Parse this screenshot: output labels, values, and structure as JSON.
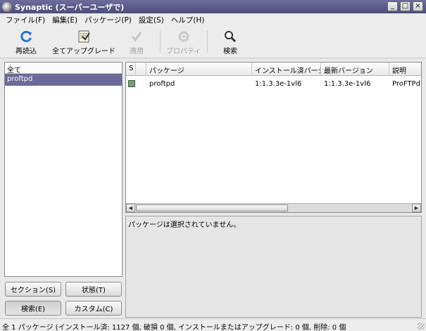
{
  "window": {
    "title": "Synaptic (スーパーユーザで)"
  },
  "menubar": {
    "items": [
      {
        "label": "ファイル(F)"
      },
      {
        "label": "編集(E)"
      },
      {
        "label": "パッケージ(P)"
      },
      {
        "label": "設定(S)"
      },
      {
        "label": "ヘルプ(H)"
      }
    ]
  },
  "toolbar": {
    "reload": {
      "label": "再読込",
      "icon": "reload-icon"
    },
    "upgrade": {
      "label": "全てアップグレード",
      "icon": "upgrade-icon"
    },
    "apply": {
      "label": "適用",
      "icon": "apply-checkmark-icon",
      "disabled": true
    },
    "properties": {
      "label": "プロパティ",
      "icon": "properties-gear-icon",
      "disabled": true
    },
    "search": {
      "label": "検索",
      "icon": "magnifier-icon"
    }
  },
  "filter_list": {
    "header": "全て",
    "items": [
      {
        "label": "proftpd",
        "selected": true
      }
    ]
  },
  "view_buttons": {
    "sections": "セクション(S)",
    "status": "状態(T)",
    "search": "検索(E)",
    "custom": "カスタム(C)"
  },
  "package_table": {
    "columns": {
      "s": "S",
      "package": "パッケージ",
      "installed": "インストール済バージョン",
      "latest": "最新バージョン",
      "desc": "説明"
    },
    "rows": [
      {
        "name": "proftpd",
        "installed": "1:1.3.3e-1vl6",
        "latest": "1:1.3.3e-1vl6",
        "desc": "ProFTPd"
      }
    ]
  },
  "description_pane": {
    "text": "パッケージは選択されていません。"
  },
  "statusbar": {
    "text": "全 1 パッケージ (インストール済: 1127 個, 破損 0 個, インストールまたはアップグレード: 0 個, 削除: 0 個"
  },
  "colors": {
    "selection": "#6b6a99",
    "titlebar": "#5b5a88",
    "installed_status": "#7c9a7c"
  }
}
